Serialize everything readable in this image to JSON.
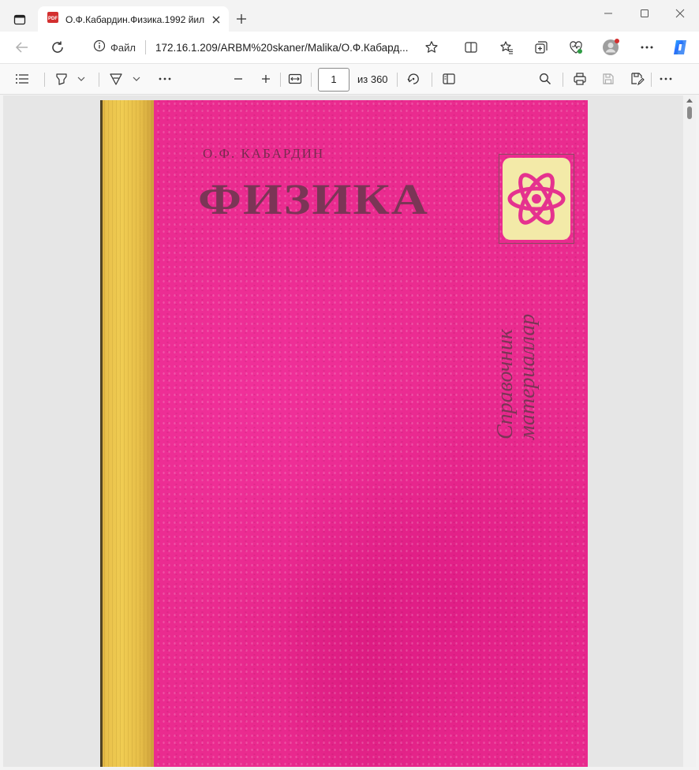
{
  "browser": {
    "tab_title": "О.Ф.Кабардин.Физика.1992 йил",
    "address_site_label": "Файл",
    "url": "172.16.1.209/ARBM%20skaner/Malika/О.Ф.Кабард...",
    "icons": {
      "tab_actions": "tab-actions-icon",
      "pdf_favicon": "pdf-icon",
      "back": "back-arrow-icon",
      "refresh": "refresh-icon",
      "info": "info-icon",
      "favorite": "star-icon"
    }
  },
  "pdf_toolbar": {
    "current_page": "1",
    "page_total": "из 360"
  },
  "document": {
    "author": "О.Ф. КАБАРДИН",
    "title": "ФИЗИКА",
    "subtitle_line1": "Справочник",
    "subtitle_line2": "материаллар",
    "cover_color": "#ea2b8f",
    "spine_color": "#f0cc52",
    "emblem_color": "#f3eaa8"
  }
}
